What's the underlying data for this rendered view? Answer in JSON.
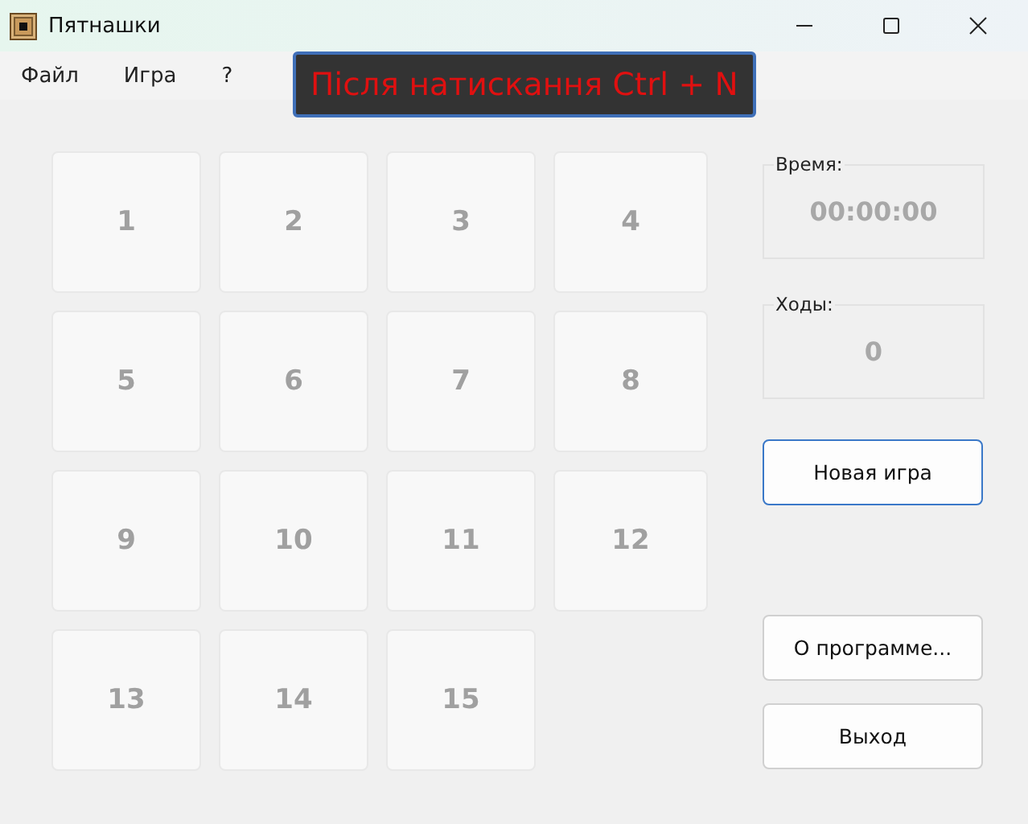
{
  "window": {
    "title": "Пятнашки"
  },
  "menu": [
    "Файл",
    "Игра",
    "?"
  ],
  "annotation": "Після натискання Ctrl + N",
  "tiles": [
    {
      "label": "1",
      "disabled": true
    },
    {
      "label": "2",
      "disabled": true
    },
    {
      "label": "3",
      "disabled": true
    },
    {
      "label": "4",
      "disabled": true
    },
    {
      "label": "5",
      "disabled": true
    },
    {
      "label": "6",
      "disabled": true
    },
    {
      "label": "7",
      "disabled": true
    },
    {
      "label": "8",
      "disabled": true
    },
    {
      "label": "9",
      "disabled": true
    },
    {
      "label": "10",
      "disabled": true
    },
    {
      "label": "11",
      "disabled": true
    },
    {
      "label": "12",
      "disabled": true
    },
    {
      "label": "13",
      "disabled": true
    },
    {
      "label": "14",
      "disabled": true
    },
    {
      "label": "15",
      "disabled": true
    }
  ],
  "time_group": {
    "label": "Время:",
    "value": "00:00:00"
  },
  "moves_group": {
    "label": "Ходы:",
    "value": "0"
  },
  "buttons": [
    {
      "label": "Новая игра",
      "focused": true
    },
    {
      "label": "О программе...",
      "focused": false
    },
    {
      "label": "Выход",
      "focused": false
    }
  ]
}
